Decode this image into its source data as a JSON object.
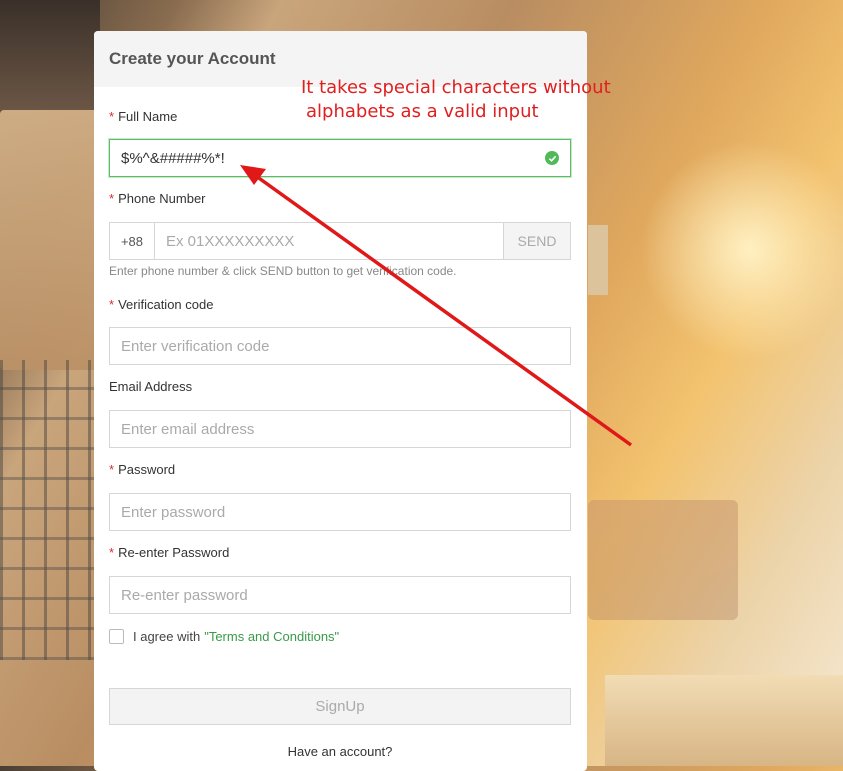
{
  "form": {
    "title": "Create your Account",
    "full_name": {
      "label": "Full Name",
      "value": "$%^&#####%*!"
    },
    "phone": {
      "label": "Phone Number",
      "prefix": "+88",
      "placeholder": "Ex 01XXXXXXXXX",
      "send_label": "SEND",
      "hint": "Enter phone number & click SEND button to get verification code."
    },
    "verification": {
      "label": "Verification code",
      "placeholder": "Enter verification code"
    },
    "email": {
      "label": "Email Address",
      "placeholder": "Enter email address"
    },
    "password": {
      "label": "Password",
      "placeholder": "Enter password"
    },
    "reenter_password": {
      "label": "Re-enter Password",
      "placeholder": "Re-enter password"
    },
    "agree": {
      "text": "I agree with",
      "terms_link": "\"Terms and Conditions\""
    },
    "signup_label": "SignUp",
    "have_account": "Have an account?",
    "required_mark": "*"
  },
  "annotation": {
    "line1": "It takes special characters without",
    "line2": "alphabets as a valid input",
    "color": "#e02020"
  },
  "colors": {
    "valid_border": "#5dbb63",
    "required": "#e02a2a",
    "link": "#3a9a4a"
  }
}
